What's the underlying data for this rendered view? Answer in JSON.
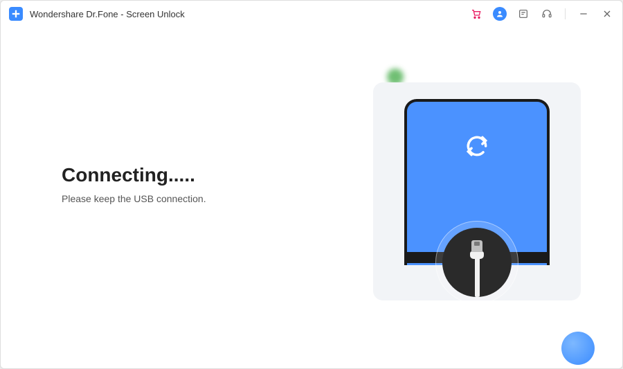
{
  "app": {
    "title": "Wondershare Dr.Fone - Screen Unlock"
  },
  "main": {
    "heading": "Connecting.....",
    "subtext": "Please keep the USB connection."
  },
  "icons": {
    "cart": "shopping-cart",
    "user": "user",
    "feedback": "feedback-form",
    "support": "headset",
    "minimize": "minimize",
    "close": "close"
  },
  "colors": {
    "accent": "#3a8bff",
    "green": "#4caf50",
    "cart": "#e91e63"
  }
}
